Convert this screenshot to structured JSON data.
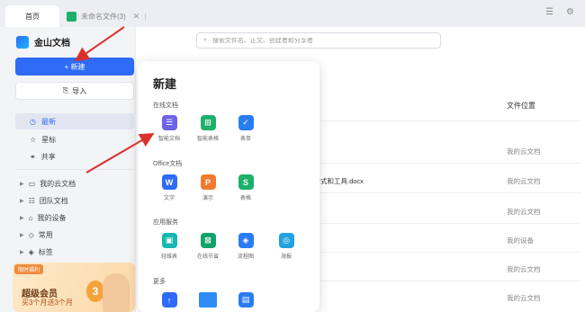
{
  "tabs": [
    {
      "label": "首页"
    },
    {
      "label": "未命名文件(3)"
    }
  ],
  "brand": {
    "name": "金山文档"
  },
  "sidebar": {
    "new_label": "+ 新建",
    "import_label": "导入",
    "nav": [
      {
        "label": "最新"
      },
      {
        "label": "星标"
      },
      {
        "label": "共享"
      }
    ],
    "tree": [
      {
        "label": "我的云文档"
      },
      {
        "label": "团队文档"
      },
      {
        "label": "我的设备"
      },
      {
        "label": "常用"
      },
      {
        "label": "标签"
      }
    ],
    "promo": {
      "badge": "限时福利",
      "title": "超级会员",
      "subtitle": "买3个月送3个月"
    }
  },
  "search": {
    "placeholder": "搜索文件名、正文、创建者和分享者"
  },
  "table": {
    "location_header": "文件位置",
    "rows": [
      {
        "name": "",
        "location": "我的云文档"
      },
      {
        "name": "的方式和工具.docx",
        "location": "我的云文档"
      },
      {
        "name": "",
        "location": "我的云文档"
      },
      {
        "name": "",
        "location": "我的设备"
      },
      {
        "name": "",
        "location": "我的云文档"
      },
      {
        "name": "",
        "location": "我的云文档"
      }
    ]
  },
  "popup": {
    "title": "新建",
    "sections": [
      {
        "label": "在线文档",
        "items": [
          {
            "label": "智能文档",
            "icon": "doc-icon",
            "color": "#6d63e7",
            "glyph": "☰"
          },
          {
            "label": "智能表格",
            "icon": "sheet-icon",
            "color": "#1db068",
            "glyph": "⊞"
          },
          {
            "label": "表单",
            "icon": "form-icon",
            "color": "#2a7cf2",
            "glyph": "✓"
          }
        ]
      },
      {
        "label": "Office文档",
        "items": [
          {
            "label": "文字",
            "icon": "word-icon",
            "color": "#2f6bf7",
            "glyph": "W"
          },
          {
            "label": "演示",
            "icon": "ppt-icon",
            "color": "#f07a2e",
            "glyph": "P"
          },
          {
            "label": "表格",
            "icon": "excel-icon",
            "color": "#1db068",
            "glyph": "S"
          }
        ]
      },
      {
        "label": "应用服务",
        "items": [
          {
            "label": "轻维表",
            "icon": "db-icon",
            "color": "#17b6b0",
            "glyph": "▣"
          },
          {
            "label": "在线节省",
            "icon": "save-icon",
            "color": "#12a36a",
            "glyph": "⊠"
          },
          {
            "label": "流程图",
            "icon": "flow-icon",
            "color": "#2a7cf2",
            "glyph": "◈"
          },
          {
            "label": "海报",
            "icon": "poster-icon",
            "color": "#22a3e0",
            "glyph": "◎"
          }
        ]
      },
      {
        "label": "更多",
        "items": [
          {
            "label": "",
            "icon": "upload-icon",
            "color": "#2f6bf7",
            "glyph": "↑"
          },
          {
            "label": "",
            "icon": "folder-icon",
            "color": "#2f8cf7",
            "glyph": "▬"
          },
          {
            "label": "",
            "icon": "template-icon",
            "color": "#2a7cf2",
            "glyph": "▤"
          }
        ]
      }
    ]
  },
  "colors": {
    "accent": "#2f6bf7",
    "annotation": "#d9312b"
  }
}
